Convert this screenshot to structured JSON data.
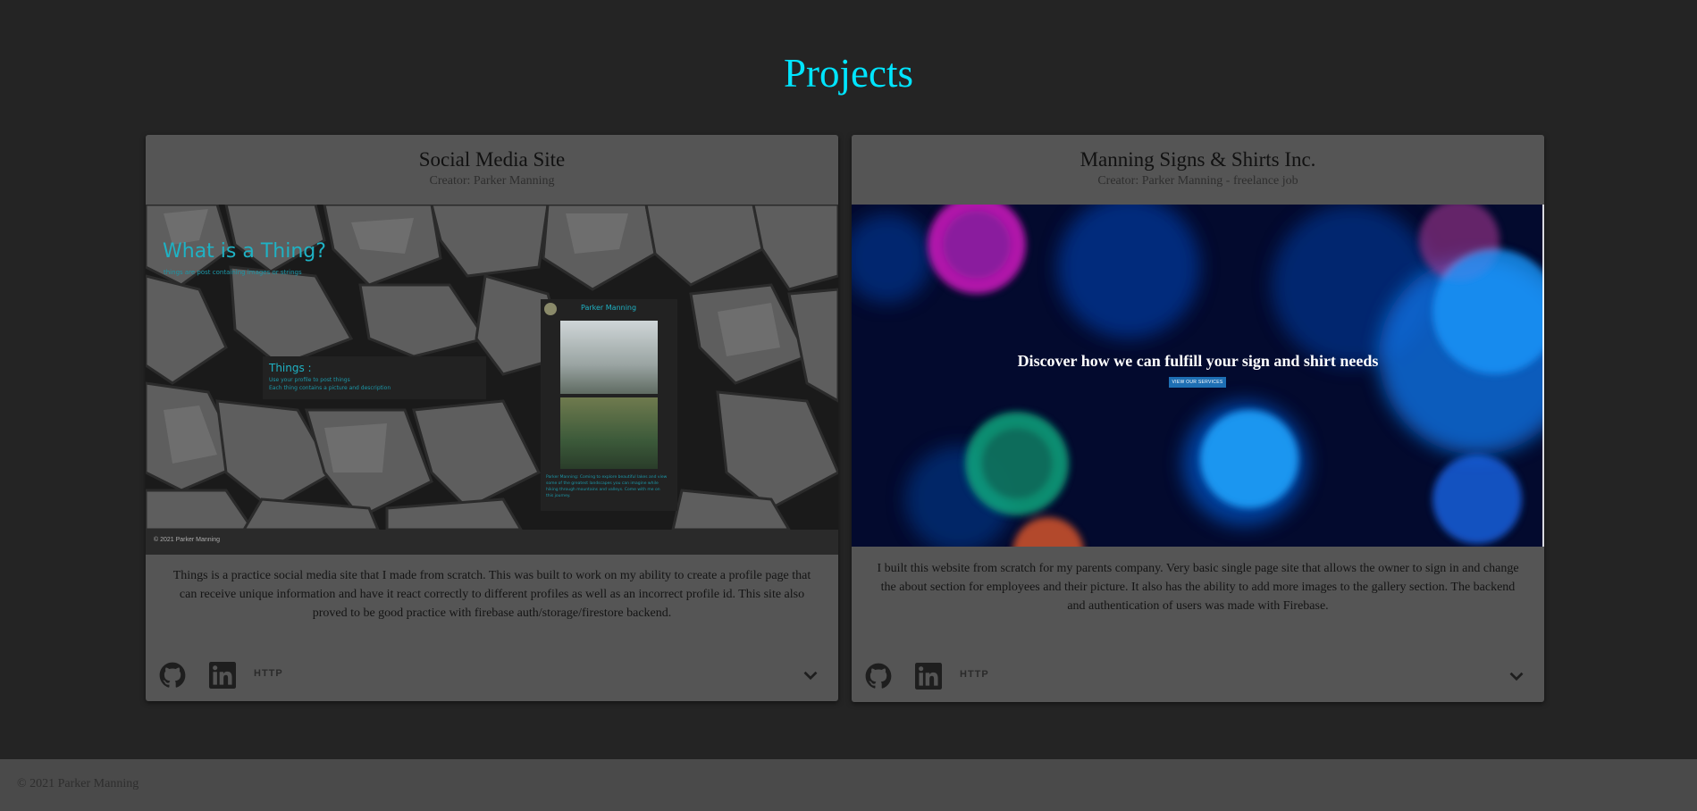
{
  "page": {
    "title": "Projects"
  },
  "projects": [
    {
      "title": "Social Media Site",
      "creator": "Creator: Parker Manning",
      "description": "Things is a practice social media site that I made from scratch. This was built to work on my ability to create a profile page that can receive unique information and have it react correctly to different profiles as well as an incorrect profile id. This site also proved to be good practice with firebase auth/storage/firestore backend.",
      "http_label": "HTTP",
      "screenshot": {
        "headline": "What is a Thing?",
        "tagline": "things are post containing images or strings",
        "box_title": "Things :",
        "box_line_1": "Use your profile to post things",
        "box_line_2": "Each thing contains a picture and description",
        "profile_name": "Parker Manning",
        "profile_text": "Parker Manning: Coming to explore beautiful lakes and view some of the greatest landscapes you can imagine while hiking through mountains and valleys. Come with me on this journey.",
        "footer": "© 2021 Parker Manning"
      }
    },
    {
      "title": "Manning Signs & Shirts Inc.",
      "creator": "Creator: Parker Manning - freelance job",
      "description": "I built this website from scratch for my parents company. Very basic single page site that allows the owner to sign in and change the about section for employees and their picture. It also has the ability to add more images to the gallery section. The backend and authentication of users was made with Firebase.",
      "http_label": "HTTP",
      "screenshot": {
        "headline": "Discover how we can fulfill your sign and shirt needs",
        "button": "VIEW OUR SERVICES"
      }
    }
  ],
  "footer": {
    "copyright": "© 2021 Parker Manning"
  },
  "colors": {
    "background": "#242424",
    "accent": "#00e5ff",
    "card": "#555555",
    "footer": "#4a4a4a"
  },
  "icons": [
    "github-icon",
    "linkedin-icon",
    "chevron-down-icon"
  ]
}
